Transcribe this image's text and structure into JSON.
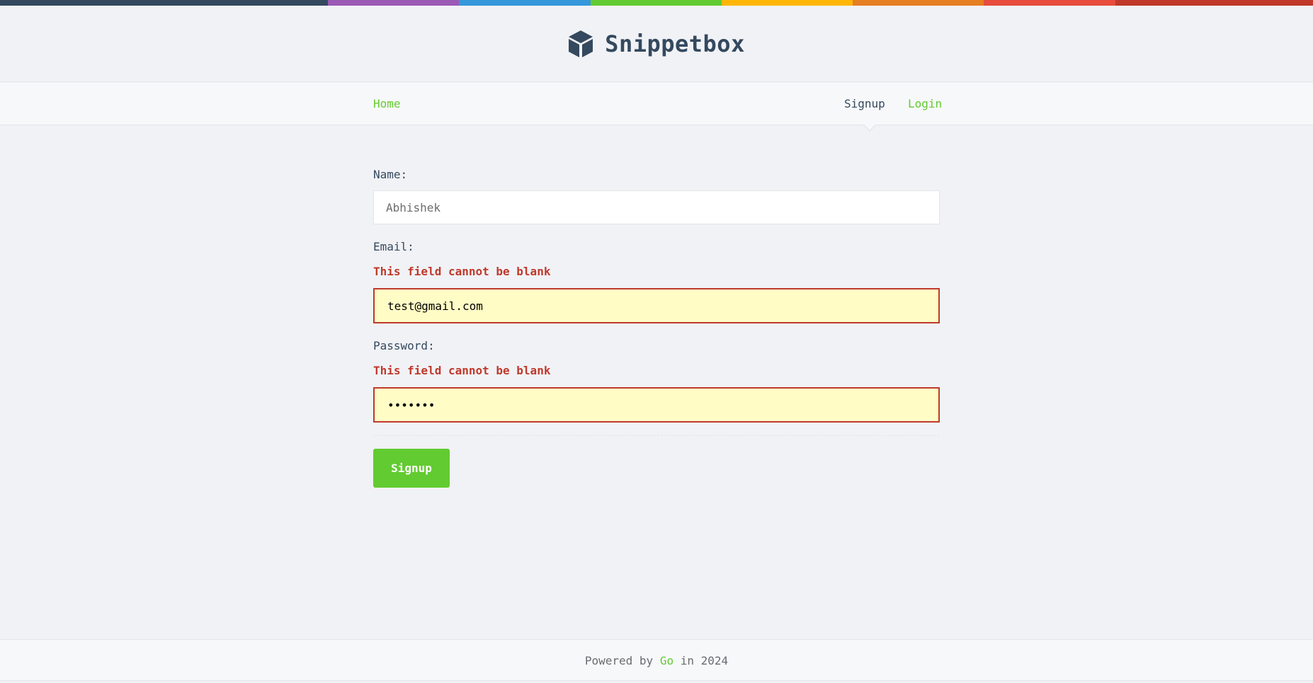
{
  "brand": {
    "title": "Snippetbox",
    "icon": "cube-icon"
  },
  "colors": {
    "accent": "#62cb31",
    "text": "#34495e",
    "error": "#c0392b",
    "error_bg": "#fffcc6",
    "stripe": [
      "#34495e",
      "#9b59b6",
      "#3498db",
      "#62cb31",
      "#ffb606",
      "#e67e22",
      "#e74c3c",
      "#c0392b"
    ]
  },
  "nav": {
    "home": "Home",
    "signup": "Signup",
    "login": "Login"
  },
  "form": {
    "name_label": "Name:",
    "name_value": "Abhishek",
    "email_label": "Email:",
    "email_error": "This field cannot be blank",
    "email_value": "test@gmail.com",
    "password_label": "Password:",
    "password_error": "This field cannot be blank",
    "password_value": "1234567",
    "submit_label": "Signup"
  },
  "footer": {
    "prefix": "Powered by",
    "link": "Go",
    "suffix": "in 2024"
  }
}
